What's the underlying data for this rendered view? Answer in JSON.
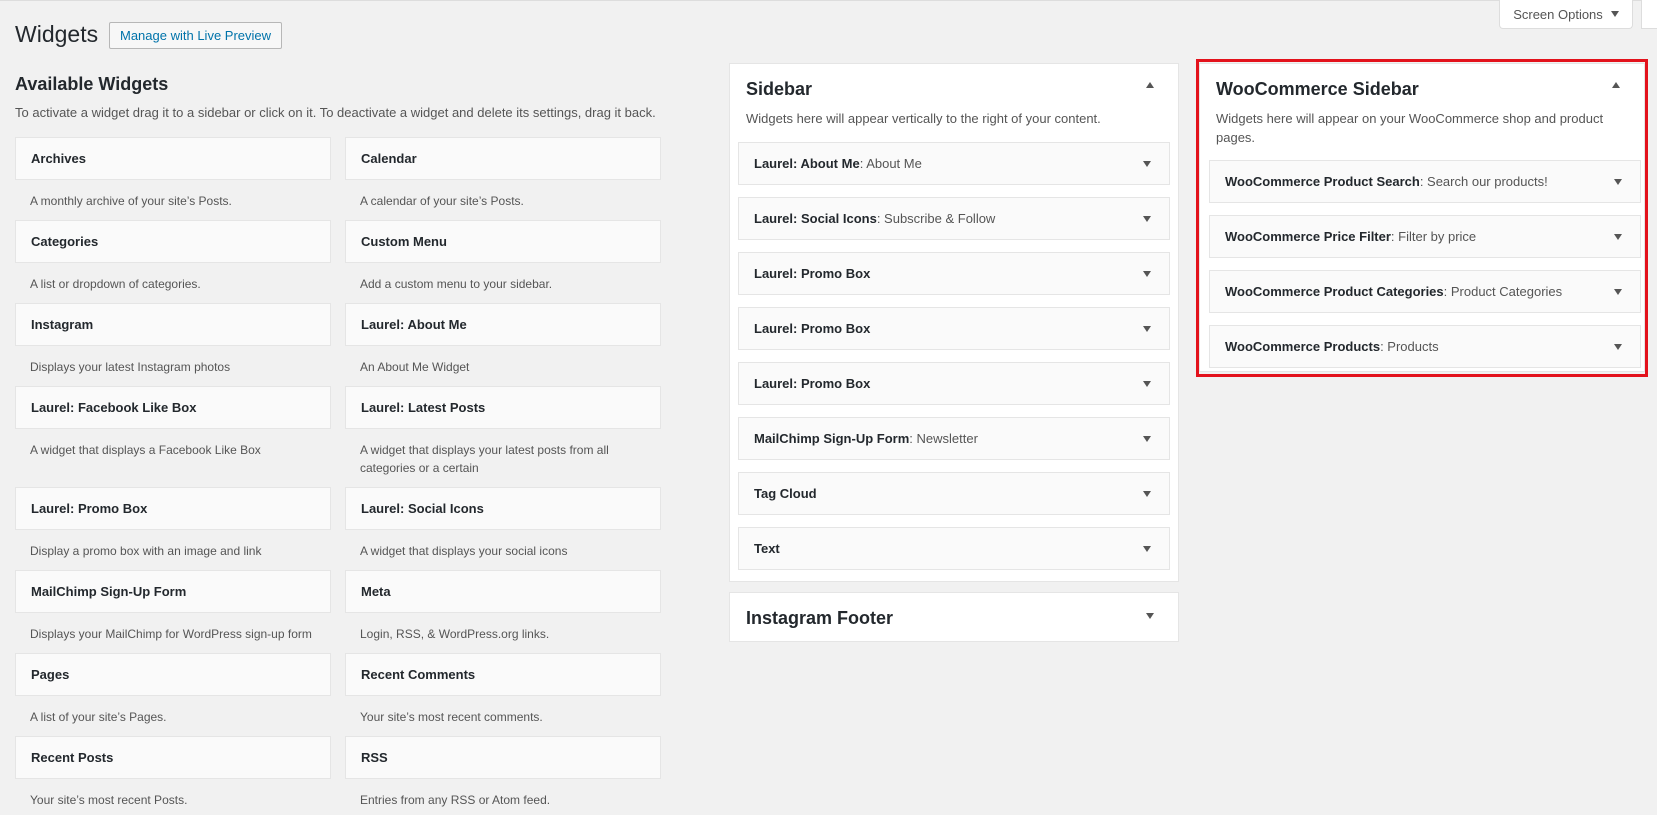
{
  "header": {
    "title": "Widgets",
    "live_preview_label": "Manage with Live Preview",
    "screen_options_label": "Screen Options"
  },
  "available": {
    "title": "Available Widgets",
    "description": "To activate a widget drag it to a sidebar or click on it. To deactivate a widget and delete its settings, drag it back.",
    "widgets": [
      {
        "name": "Archives",
        "desc": "A monthly archive of your site’s Posts."
      },
      {
        "name": "Calendar",
        "desc": "A calendar of your site’s Posts."
      },
      {
        "name": "Categories",
        "desc": "A list or dropdown of categories."
      },
      {
        "name": "Custom Menu",
        "desc": "Add a custom menu to your sidebar."
      },
      {
        "name": "Instagram",
        "desc": "Displays your latest Instagram photos"
      },
      {
        "name": "Laurel: About Me",
        "desc": "An About Me Widget"
      },
      {
        "name": "Laurel: Facebook Like Box",
        "desc": "A widget that displays a Facebook Like Box"
      },
      {
        "name": "Laurel: Latest Posts",
        "desc": "A widget that displays your latest posts from all categories or a certain"
      },
      {
        "name": "Laurel: Promo Box",
        "desc": "Display a promo box with an image and link"
      },
      {
        "name": "Laurel: Social Icons",
        "desc": "A widget that displays your social icons"
      },
      {
        "name": "MailChimp Sign-Up Form",
        "desc": "Displays your MailChimp for WordPress sign-up form"
      },
      {
        "name": "Meta",
        "desc": "Login, RSS, & WordPress.org links."
      },
      {
        "name": "Pages",
        "desc": "A list of your site’s Pages."
      },
      {
        "name": "Recent Comments",
        "desc": "Your site’s most recent comments."
      },
      {
        "name": "Recent Posts",
        "desc": "Your site’s most recent Posts."
      },
      {
        "name": "RSS",
        "desc": "Entries from any RSS or Atom feed."
      }
    ]
  },
  "sidebar": {
    "title": "Sidebar",
    "description": "Widgets here will appear vertically to the right of your content.",
    "widgets": [
      {
        "name": "Laurel: About Me",
        "title": ": About Me"
      },
      {
        "name": "Laurel: Social Icons",
        "title": ": Subscribe & Follow"
      },
      {
        "name": "Laurel: Promo Box",
        "title": ""
      },
      {
        "name": "Laurel: Promo Box",
        "title": ""
      },
      {
        "name": "Laurel: Promo Box",
        "title": ""
      },
      {
        "name": "MailChimp Sign-Up Form",
        "title": ": Newsletter"
      },
      {
        "name": "Tag Cloud",
        "title": ""
      },
      {
        "name": "Text",
        "title": ""
      }
    ]
  },
  "instagram_footer": {
    "title": "Instagram Footer"
  },
  "woocommerce_sidebar": {
    "title": "WooCommerce Sidebar",
    "description": "Widgets here will appear on your WooCommerce shop and product pages.",
    "widgets": [
      {
        "name": "WooCommerce Product Search",
        "title": ": Search our products!"
      },
      {
        "name": "WooCommerce Price Filter",
        "title": ": Filter by price"
      },
      {
        "name": "WooCommerce Product Categories",
        "title": ": Product Categories"
      },
      {
        "name": "WooCommerce Products",
        "title": ": Products"
      }
    ]
  },
  "colors": {
    "highlight": "#e3121c",
    "link": "#0073aa",
    "background": "#f1f1f1"
  }
}
